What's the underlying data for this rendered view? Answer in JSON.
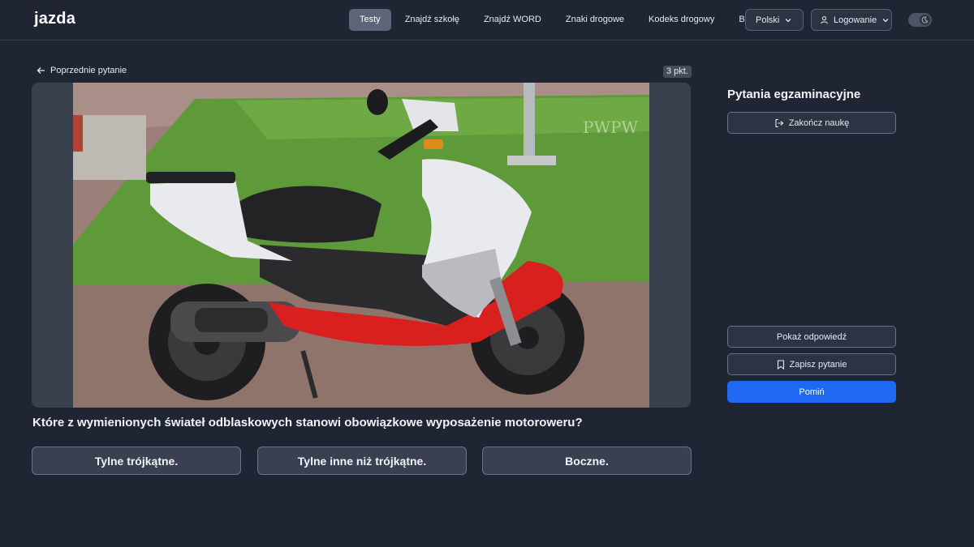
{
  "header": {
    "logo": "jazda",
    "nav": [
      {
        "label": "Testy",
        "active": true
      },
      {
        "label": "Znajdź szkołę",
        "active": false
      },
      {
        "label": "Znajdź WORD",
        "active": false
      },
      {
        "label": "Znaki drogowe",
        "active": false
      },
      {
        "label": "Kodeks drogowy",
        "active": false
      },
      {
        "label": "Blog",
        "active": false
      }
    ],
    "language": "Polski",
    "login": "Logowanie",
    "icons": {
      "language": "chevron-down-icon",
      "login": "user-icon",
      "theme": "moon-icon"
    }
  },
  "main": {
    "prev_question": "Poprzednie pytanie",
    "points": "3 pkt.",
    "watermark": "PWPW",
    "question": "Które z wymienionych świateł odblaskowych stanowi obowiązkowe wyposażenie motoroweru?",
    "answers": [
      "Tylne trójkątne.",
      "Tylne inne niż trójkątne.",
      "Boczne."
    ]
  },
  "sidebar": {
    "title": "Pytania egzaminacyjne",
    "finish": "Zakończ naukę",
    "show_answer": "Pokaż odpowiedź",
    "save_question": "Zapisz pytanie",
    "skip": "Pomiń"
  },
  "colors": {
    "background": "#1f2533",
    "accent": "#1f68f2",
    "active_nav": "#5c6678",
    "scooter_red": "#d8201e",
    "scooter_white": "#e9eaee"
  }
}
